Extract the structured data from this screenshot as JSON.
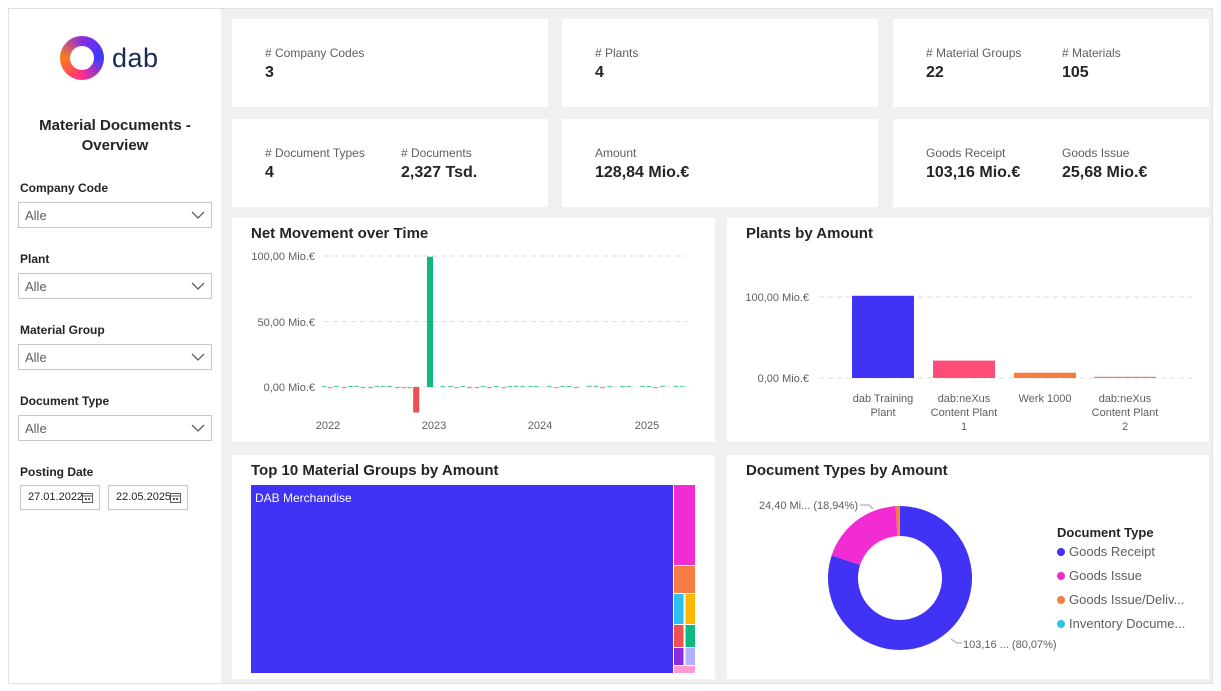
{
  "logo": {
    "text": "dab"
  },
  "sidebar": {
    "title_line1": "Material Documents -",
    "title_line2": "Overview",
    "filters": [
      {
        "label": "Company Code",
        "value": "Alle"
      },
      {
        "label": "Plant",
        "value": "Alle"
      },
      {
        "label": "Material Group",
        "value": "Alle"
      },
      {
        "label": "Document Type",
        "value": "Alle"
      }
    ],
    "posting_date": {
      "label": "Posting Date",
      "from": "27.01.2022",
      "to": "22.05.2025"
    }
  },
  "kpis": {
    "company_codes": {
      "label": "# Company Codes",
      "value": "3"
    },
    "plants": {
      "label": "# Plants",
      "value": "4"
    },
    "material_groups": {
      "label": "# Material Groups",
      "value": "22"
    },
    "materials": {
      "label": "# Materials",
      "value": "105"
    },
    "document_types": {
      "label": "# Document Types",
      "value": "4"
    },
    "documents": {
      "label": "# Documents",
      "value": "2,327 Tsd."
    },
    "amount": {
      "label": "Amount",
      "value": "128,84 Mio.€"
    },
    "goods_receipt": {
      "label": "Goods Receipt",
      "value": "103,16 Mio.€"
    },
    "goods_issue": {
      "label": "Goods Issue",
      "value": "25,68 Mio.€"
    }
  },
  "colors": {
    "blue": "#4133f5",
    "pink": "#ff2d62",
    "magenta": "#f02cd2",
    "orange": "#f57c42",
    "green": "#10b982",
    "red": "#ef4f4f",
    "cyan": "#2ec0f0",
    "yellow": "#ffb800",
    "text": "#252423",
    "muted": "#605e5c",
    "grid": "#dddddd"
  },
  "chart_data": [
    {
      "type": "bar",
      "title": "Net Movement over Time",
      "yaxis_ticks": [
        "100,00 Mio.€",
        "50,00 Mio.€",
        "0,00 Mio.€"
      ],
      "ylim": [
        -20,
        100
      ],
      "x_tick_labels": [
        "2022",
        "2023",
        "2024",
        "2025"
      ],
      "x_start": 2022.0,
      "bar_width": 0.043,
      "series": [
        {
          "values": [
            {
              "x": 2021.96,
              "y": 0.3
            },
            {
              "x": 2022.02,
              "y": -0.3
            },
            {
              "x": 2022.08,
              "y": 0.2
            },
            {
              "x": 2022.15,
              "y": -0.2
            },
            {
              "x": 2022.21,
              "y": 0.3
            },
            {
              "x": 2022.27,
              "y": 0.2
            },
            {
              "x": 2022.33,
              "y": -0.3
            },
            {
              "x": 2022.4,
              "y": -0.4
            },
            {
              "x": 2022.46,
              "y": 0.3
            },
            {
              "x": 2022.52,
              "y": 0.5
            },
            {
              "x": 2022.58,
              "y": 0.3
            },
            {
              "x": 2022.65,
              "y": -0.5
            },
            {
              "x": 2022.71,
              "y": -0.8
            },
            {
              "x": 2022.77,
              "y": -1.0
            },
            {
              "x": 2022.83,
              "y": -19.5
            },
            {
              "x": 2022.96,
              "y": 99.5
            },
            {
              "x": 2023.08,
              "y": 0.4
            },
            {
              "x": 2023.15,
              "y": 0.5
            },
            {
              "x": 2023.21,
              "y": -0.3
            },
            {
              "x": 2023.27,
              "y": 0.4
            },
            {
              "x": 2023.33,
              "y": -0.5
            },
            {
              "x": 2023.4,
              "y": -0.3
            },
            {
              "x": 2023.46,
              "y": 0.3
            },
            {
              "x": 2023.52,
              "y": -0.4
            },
            {
              "x": 2023.58,
              "y": 0.3
            },
            {
              "x": 2023.65,
              "y": -0.3
            },
            {
              "x": 2023.71,
              "y": 0.3
            },
            {
              "x": 2023.77,
              "y": 0.2
            },
            {
              "x": 2023.83,
              "y": 0.4
            },
            {
              "x": 2023.9,
              "y": 0.3
            },
            {
              "x": 2023.96,
              "y": 0.5
            },
            {
              "x": 2024.08,
              "y": 0.3
            },
            {
              "x": 2024.15,
              "y": -0.2
            },
            {
              "x": 2024.21,
              "y": 0.3
            },
            {
              "x": 2024.27,
              "y": 0.2
            },
            {
              "x": 2024.33,
              "y": -0.3
            },
            {
              "x": 2024.46,
              "y": 0.3
            },
            {
              "x": 2024.52,
              "y": 0.4
            },
            {
              "x": 2024.58,
              "y": -0.3
            },
            {
              "x": 2024.65,
              "y": 0.5
            },
            {
              "x": 2024.77,
              "y": 0.3
            },
            {
              "x": 2024.83,
              "y": 0.2
            },
            {
              "x": 2024.96,
              "y": 0.4
            },
            {
              "x": 2025.02,
              "y": 0.3
            },
            {
              "x": 2025.08,
              "y": -0.2
            },
            {
              "x": 2025.15,
              "y": 0.3
            },
            {
              "x": 2025.27,
              "y": 0.4
            },
            {
              "x": 2025.33,
              "y": 0.3
            }
          ]
        }
      ]
    },
    {
      "type": "bar",
      "title": "Plants by Amount",
      "yaxis_ticks": [
        "100,00 Mio.€",
        "0,00 Mio.€"
      ],
      "ylim": [
        0,
        100
      ],
      "categories": [
        [
          "dab Training",
          "Plant"
        ],
        [
          "dab:neXus",
          "Content Plant",
          "1"
        ],
        [
          "Werk 1000",
          "",
          ""
        ],
        [
          "dab:neXus",
          "Content Plant",
          "2"
        ]
      ],
      "values": [
        101.5,
        21.5,
        6.5,
        1.0
      ],
      "colors": [
        "#4133f5",
        "#ff4d78",
        "#f57c42",
        "#f57c42"
      ]
    },
    {
      "type": "heatmap",
      "title": "Top 10 Material Groups by Amount",
      "categories": [
        "DAB Merchandise"
      ],
      "values": [
        100.0,
        3.5,
        1.1,
        1.0,
        0.6,
        0.6,
        0.5,
        0.4,
        0.3,
        0.3,
        0.2
      ],
      "colors": [
        "#4133f5",
        "#f02cd2",
        "#f57c42",
        "#2ec0f0",
        "#ffb800",
        "#ef4f4f",
        "#10b982",
        "#8a2be2",
        "#b0b0ff",
        "#ff9ad5"
      ]
    },
    {
      "type": "pie",
      "title": "Document Types by Amount",
      "legend_title": "Document Type",
      "categories": [
        "Goods Receipt",
        "Goods Issue",
        "Goods Issue/Deliv...",
        "Inventory Docume..."
      ],
      "values": [
        80.07,
        18.94,
        0.9,
        0.09
      ],
      "colors": [
        "#4133f5",
        "#f02cd2",
        "#f57c42",
        "#2ec0f0"
      ],
      "data_labels": [
        "103,16 ... (80,07%)",
        "24,40 Mi... (18,94%)"
      ]
    }
  ]
}
